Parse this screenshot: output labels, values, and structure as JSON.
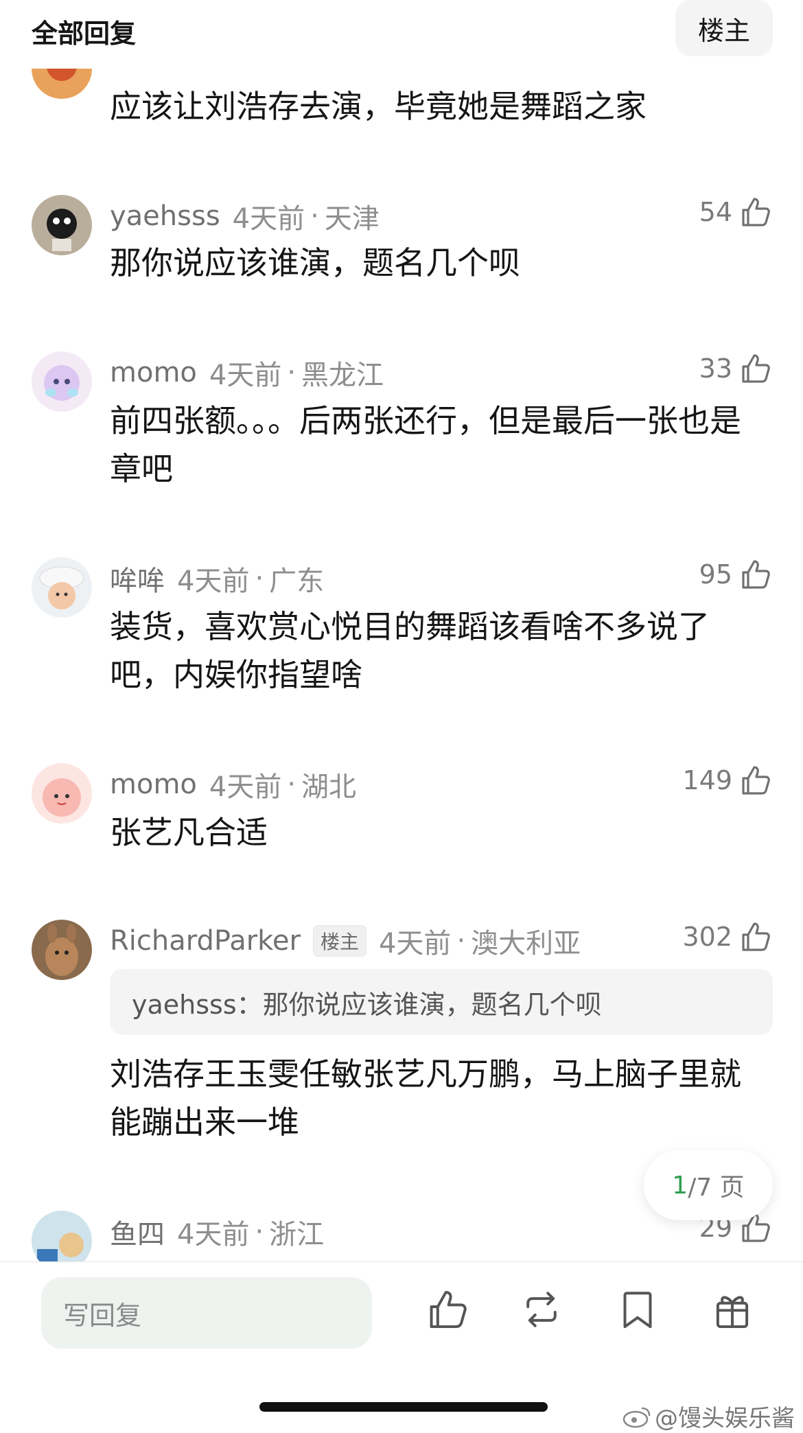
{
  "header": {
    "title": "全部回复",
    "owner_button": "楼主"
  },
  "comments": [
    {
      "text": "应该让刘浩存去演，毕竟她是舞蹈之家"
    },
    {
      "username": "yaehsss",
      "time": "4天前",
      "location": "天津",
      "likes": "54",
      "text": "那你说应该谁演，题名几个呗"
    },
    {
      "username": "momo",
      "time": "4天前",
      "location": "黑龙江",
      "likes": "33",
      "text": "前四张额。。。后两张还行，但是最后一张也是章吧"
    },
    {
      "username": "哞哞",
      "time": "4天前",
      "location": "广东",
      "likes": "95",
      "text": "装货，喜欢赏心悦目的舞蹈该看啥不多说了吧，内娱你指望啥"
    },
    {
      "username": "momo",
      "time": "4天前",
      "location": "湖北",
      "likes": "149",
      "text": "张艺凡合适"
    },
    {
      "username": "RichardParker",
      "badge": "楼主",
      "time": "4天前",
      "location": "澳大利亚",
      "likes": "302",
      "quote": "yaehsss：那你说应该谁演，题名几个呗",
      "text": "刘浩存王玉雯任敏张艺凡万鹏，马上脑子里就能蹦出来一堆"
    },
    {
      "username": "鱼四",
      "time": "4天前",
      "location": "浙江",
      "likes": "29"
    }
  ],
  "meta_separator": "·",
  "pager": {
    "current": "1",
    "rest": "/7 页"
  },
  "bottom_bar": {
    "reply_placeholder": "写回复",
    "icons": [
      "thumbs-up-icon",
      "repost-icon",
      "bookmark-icon",
      "gift-icon"
    ]
  },
  "watermark": "@馒头娱乐酱",
  "colors": {
    "accent_green": "#2e9e4f",
    "reply_bg": "#eef3ef"
  }
}
